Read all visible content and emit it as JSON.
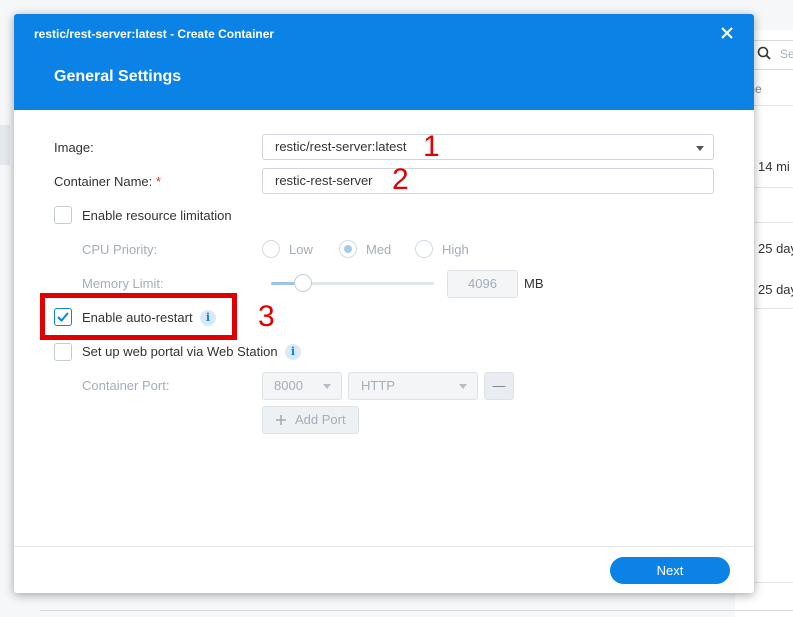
{
  "background": {
    "search_placeholder": "Se",
    "column_header": "me",
    "rows": [
      "14 mi",
      "25 day",
      "25 day"
    ]
  },
  "dialog": {
    "window_title": "restic/rest-server:latest - Create Container",
    "heading": "General Settings",
    "image_label": "Image:",
    "image_value": "restic/rest-server:latest",
    "container_name_label": "Container Name:",
    "required_mark": "*",
    "container_name_value": "restic-rest-server",
    "resource_limit_label": "Enable resource limitation",
    "resource_limit_checked": false,
    "cpu_priority_label": "CPU Priority:",
    "cpu_options": [
      "Low",
      "Med",
      "High"
    ],
    "cpu_selected": "Med",
    "memory_limit_label": "Memory Limit:",
    "memory_value": "4096",
    "memory_unit": "MB",
    "auto_restart_label": "Enable auto-restart",
    "auto_restart_checked": true,
    "web_portal_label": "Set up web portal via Web Station",
    "web_portal_checked": false,
    "container_port_label": "Container Port:",
    "port_value": "8000",
    "protocol_value": "HTTP",
    "remove_port_label": "—",
    "add_port_label": "Add Port",
    "next_label": "Next"
  },
  "annotations": [
    "1",
    "2",
    "3"
  ],
  "colors": {
    "accent": "#0b83e6",
    "annotation": "#e00000"
  }
}
